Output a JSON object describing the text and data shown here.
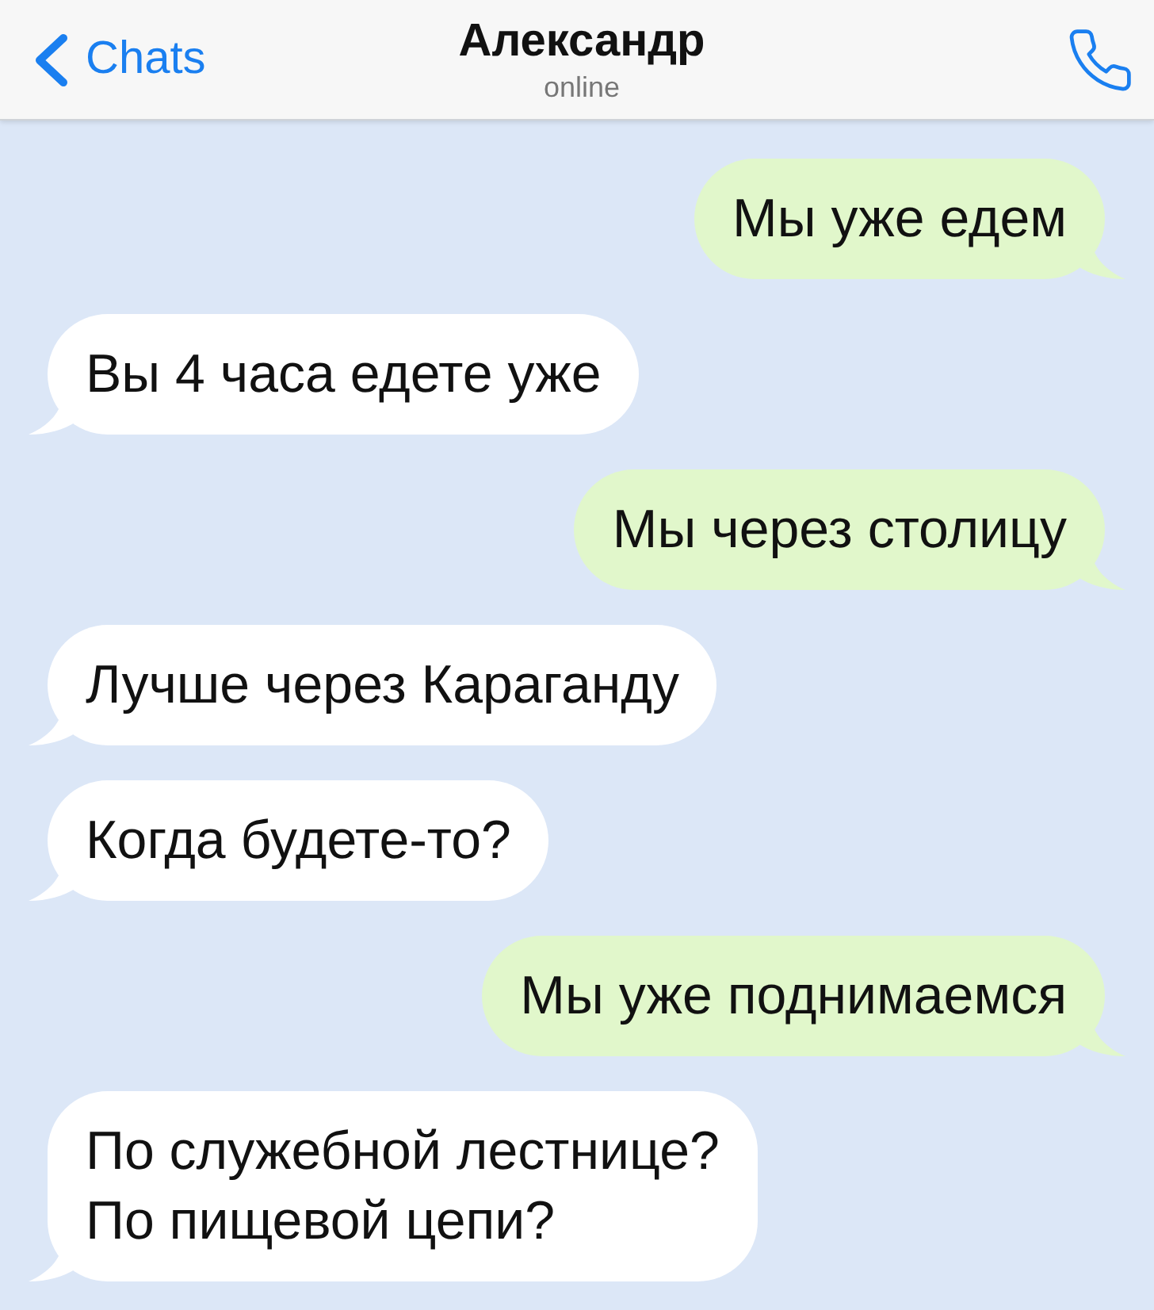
{
  "header": {
    "back_label": "Chats",
    "title": "Александр",
    "status": "online"
  },
  "messages": [
    {
      "kind": "outgoing",
      "text": "Мы уже едем"
    },
    {
      "kind": "incoming",
      "text": "Вы 4 часа едете уже"
    },
    {
      "kind": "outgoing",
      "text": "Мы через столицу"
    },
    {
      "kind": "incoming",
      "text": "Лучше через Караганду"
    },
    {
      "kind": "incoming",
      "text": "Когда будете-то?"
    },
    {
      "kind": "outgoing",
      "text": "Мы уже поднимаемся"
    },
    {
      "kind": "incoming",
      "text": "По служебной лестнице?\nПо пищевой цепи?"
    }
  ]
}
